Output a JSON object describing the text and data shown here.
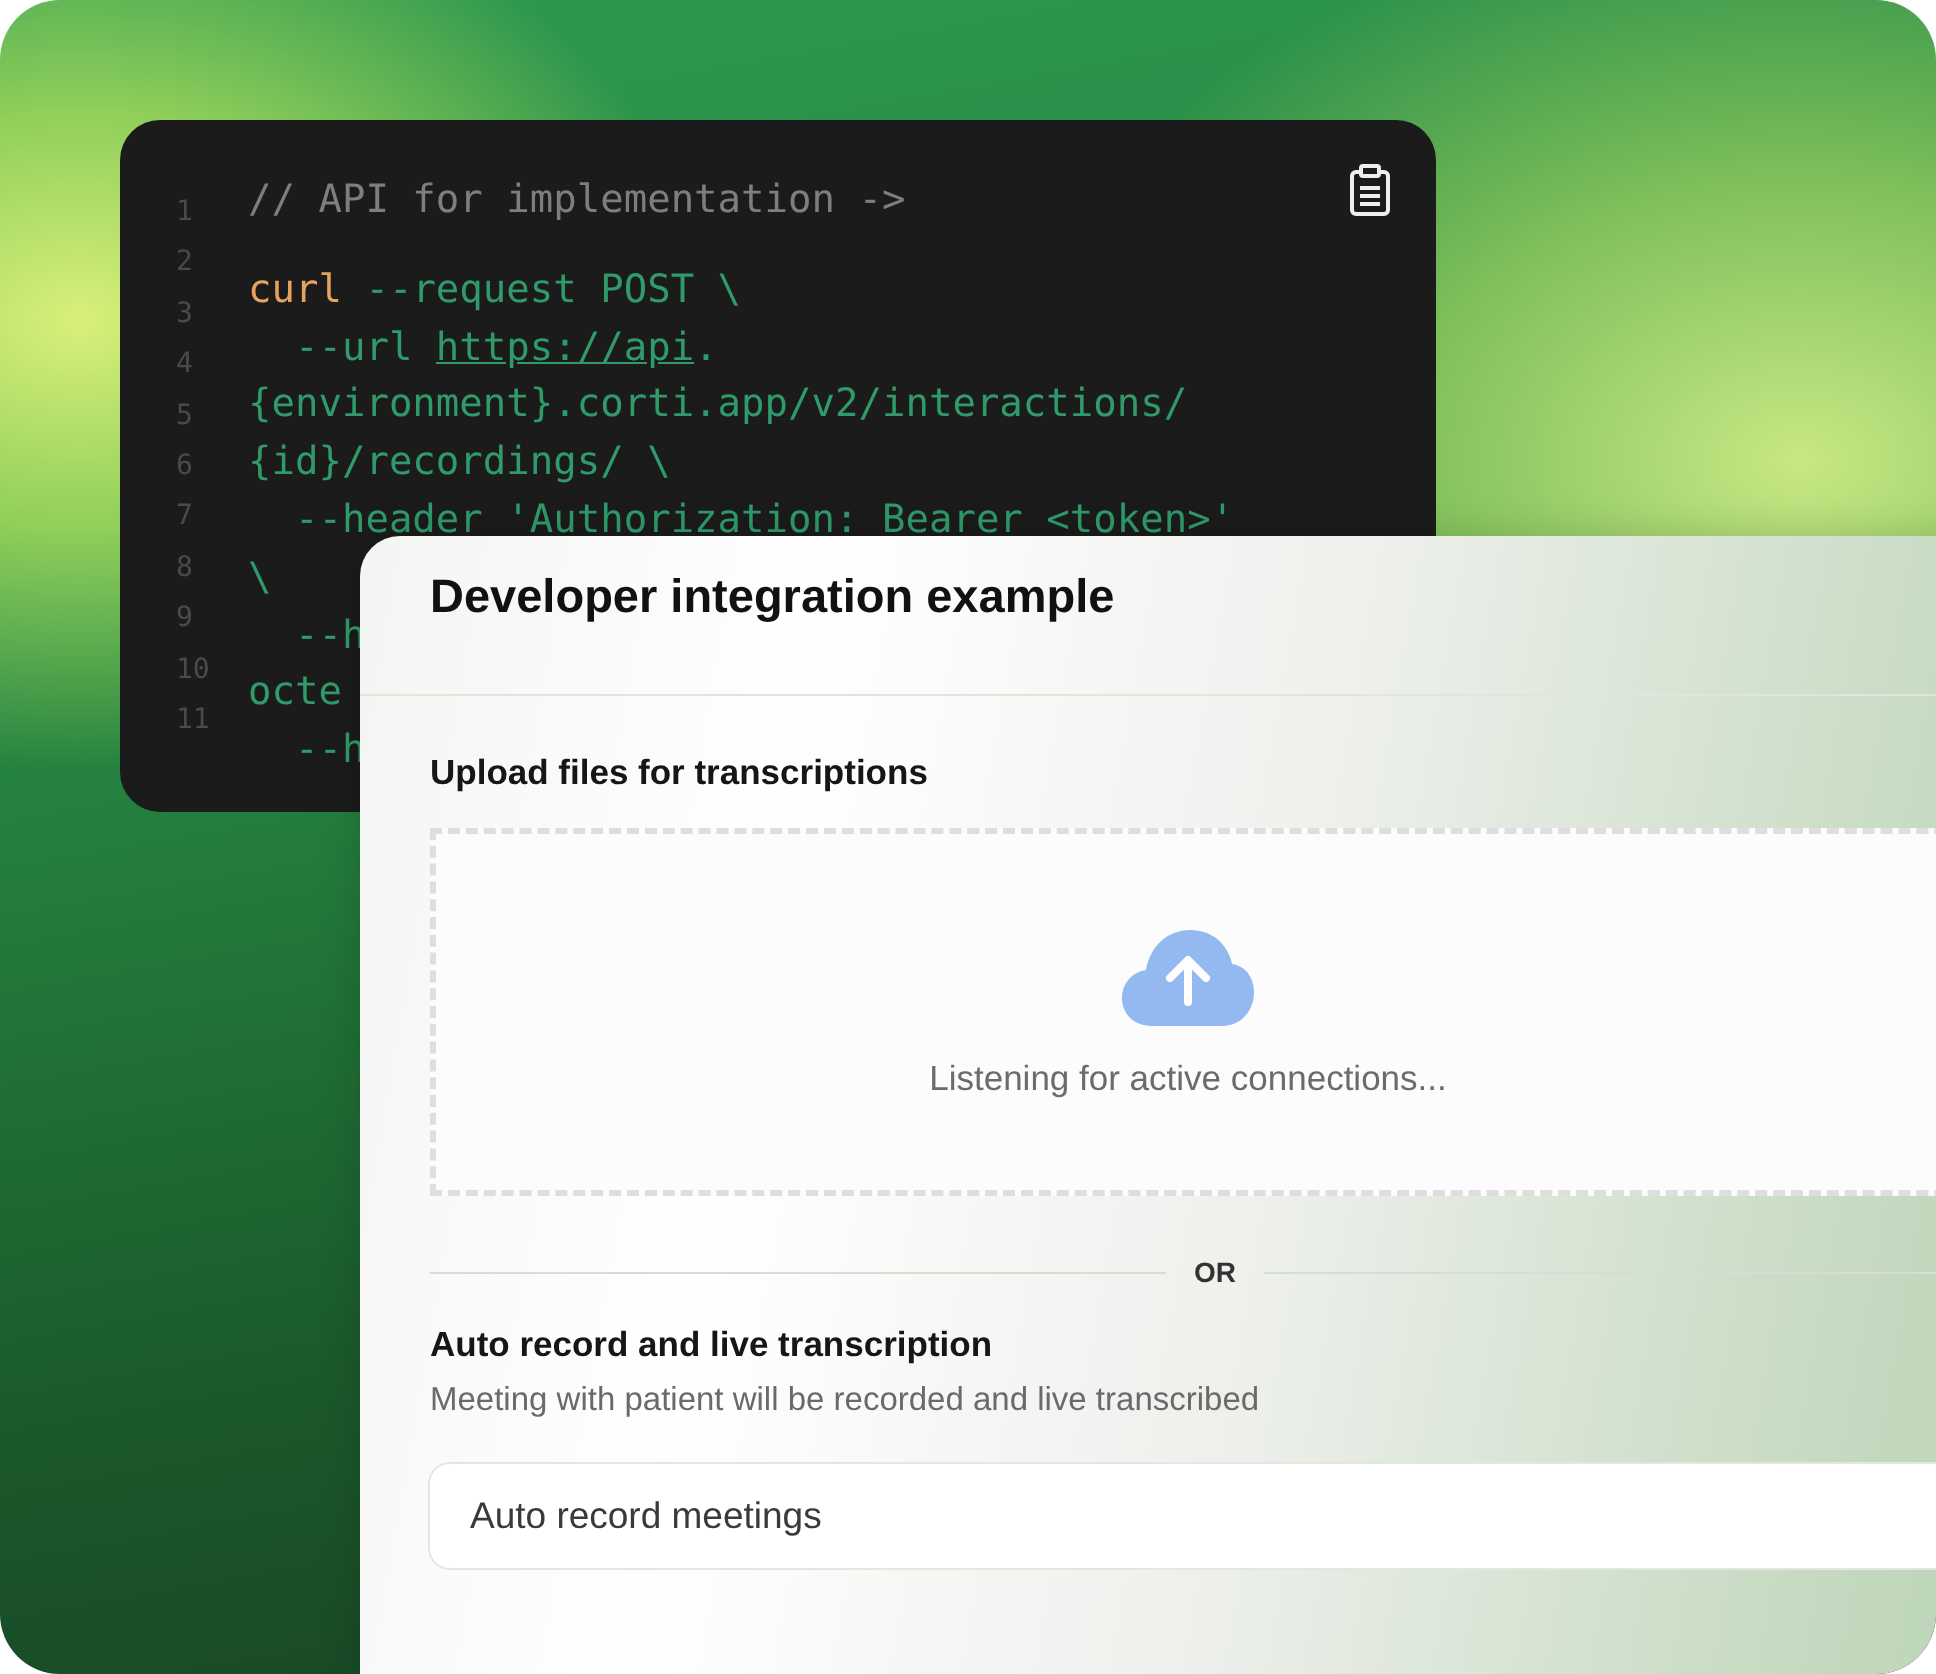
{
  "code_panel": {
    "line_numbers": [
      "1",
      "2",
      "3",
      "4",
      "5",
      "6",
      "7",
      "8",
      "9",
      "10",
      "11"
    ],
    "lines": [
      {
        "tokens": [
          {
            "kind": "comment",
            "text": "// API for implementation ->"
          }
        ]
      },
      {
        "tokens": [
          {
            "kind": "keyword",
            "text": "curl"
          },
          {
            "kind": "plain",
            "text": " --request POST \\"
          }
        ]
      },
      {
        "tokens": [
          {
            "kind": "plain",
            "text": "  --url "
          },
          {
            "kind": "link",
            "text": "https://api"
          },
          {
            "kind": "plain",
            "text": "."
          }
        ]
      },
      {
        "tokens": [
          {
            "kind": "plain",
            "text": "{environment}.corti.app/v2/interactions/"
          }
        ]
      },
      {
        "tokens": [
          {
            "kind": "plain",
            "text": "{id}/recordings/ \\"
          }
        ]
      },
      {
        "tokens": [
          {
            "kind": "plain",
            "text": "  --header 'Authorization: Bearer <token>'"
          }
        ]
      },
      {
        "tokens": [
          {
            "kind": "plain",
            "text": "\\"
          }
        ]
      },
      {
        "tokens": [
          {
            "kind": "plain",
            "text": "  --h"
          }
        ]
      },
      {
        "tokens": [
          {
            "kind": "plain",
            "text": "octe"
          }
        ]
      },
      {
        "tokens": [
          {
            "kind": "plain",
            "text": "  --h"
          }
        ]
      }
    ]
  },
  "card": {
    "title": "Developer integration example",
    "upload": {
      "heading": "Upload files for transcriptions",
      "status": "Listening for active connections..."
    },
    "separator": "OR",
    "auto_record": {
      "heading": "Auto record and live transcription",
      "description": "Meeting with patient will be recorded and live transcribed",
      "field_value": "Auto record meetings"
    }
  }
}
